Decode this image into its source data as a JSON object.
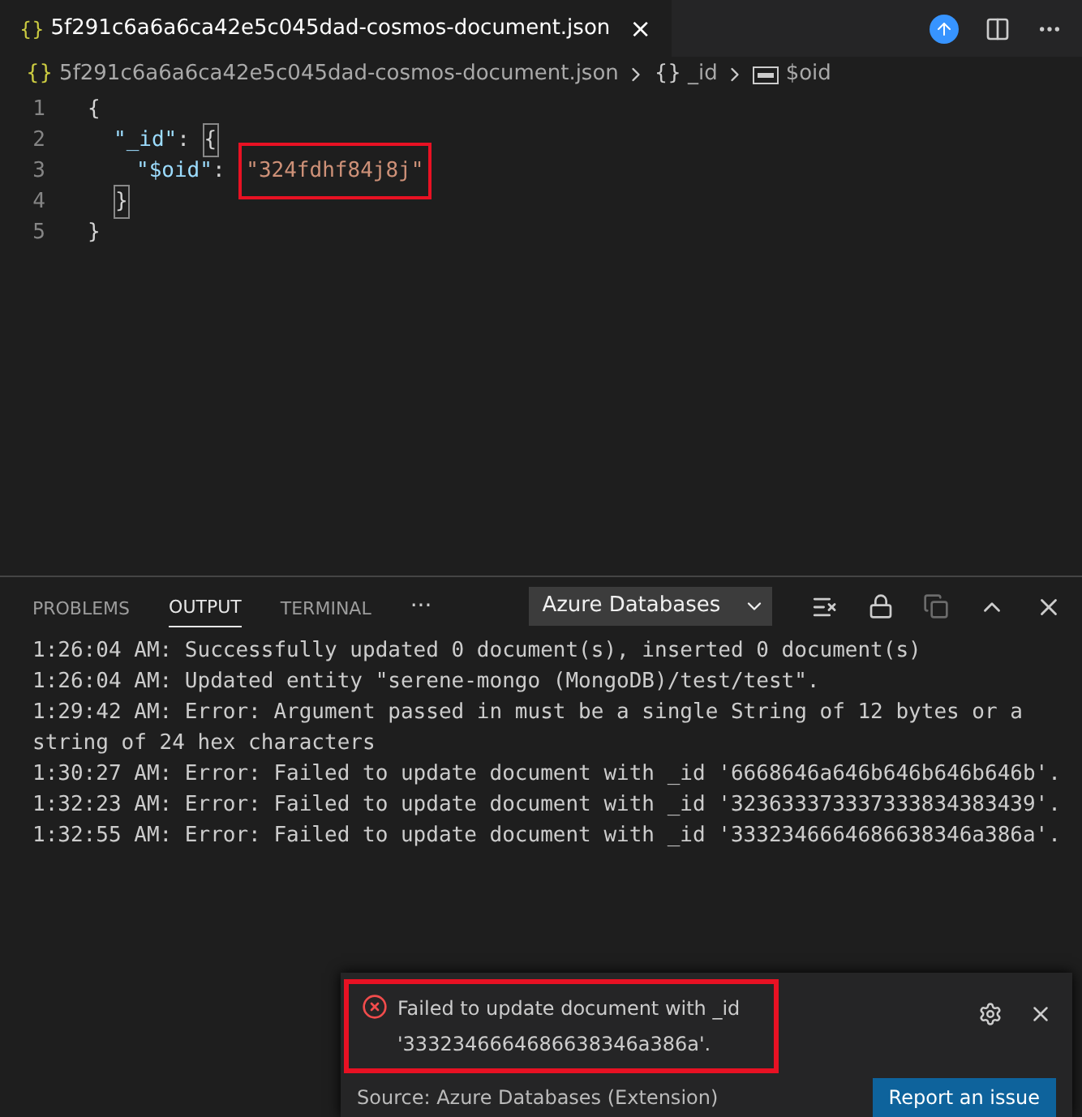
{
  "editor_tab": {
    "icon_text": "{}",
    "title": "5f291c6a6a6ca42e5c045dad-cosmos-document.json",
    "close": "×"
  },
  "breadcrumb": [
    {
      "kind": "file",
      "icon_text": "{}",
      "label": "5f291c6a6a6ca42e5c045dad-cosmos-document.json"
    },
    {
      "kind": "object",
      "icon_text": "{}",
      "label": "_id"
    },
    {
      "kind": "string",
      "label": "$oid"
    }
  ],
  "code_lines": [
    {
      "number": "1",
      "tokens": [
        {
          "kind": "punct",
          "text": "{"
        }
      ]
    },
    {
      "number": "2",
      "tokens": [
        {
          "kind": "key",
          "text": "\"_id\""
        },
        {
          "kind": "punct",
          "text": ": "
        },
        {
          "kind": "punct",
          "text": "{",
          "matched": true
        }
      ]
    },
    {
      "number": "3",
      "tokens": [
        {
          "kind": "key",
          "text": "\"$oid\""
        },
        {
          "kind": "punct",
          "text": ": "
        },
        {
          "kind": "string",
          "text": "\"324fdhf84j8j\"",
          "highlighted": true
        }
      ]
    },
    {
      "number": "4",
      "tokens": [
        {
          "kind": "punct",
          "text": "}",
          "matched": true
        }
      ]
    },
    {
      "number": "5",
      "tokens": [
        {
          "kind": "punct",
          "text": "}"
        }
      ]
    }
  ],
  "panel": {
    "tabs": [
      {
        "label": "PROBLEMS",
        "selected": false
      },
      {
        "label": "OUTPUT",
        "selected": true
      },
      {
        "label": "TERMINAL",
        "selected": false
      }
    ],
    "more": "···",
    "channel": "Azure Databases",
    "output_lines": [
      "1:26:04 AM: Successfully updated 0 document(s), inserted 0 document(s)",
      "1:26:04 AM: Updated entity \"serene-mongo (MongoDB)/test/test\".",
      "1:29:42 AM: Error: Argument passed in must be a single String of 12 bytes or a string of 24 hex characters",
      "1:30:27 AM: Error: Failed to update document with _id '6668646a646b646b646b646b'.",
      "1:32:23 AM: Error: Failed to update document with _id '323633373337333834383439'.",
      "1:32:55 AM: Error: Failed to update document with _id '3332346664686638346a386a'."
    ]
  },
  "notification": {
    "message_line_1": "Failed to update document with _id",
    "message_line_2": "'3332346664686638346a386a'.",
    "highlighted": true,
    "source": "Source: Azure Databases (Extension)",
    "button": "Report an issue"
  }
}
